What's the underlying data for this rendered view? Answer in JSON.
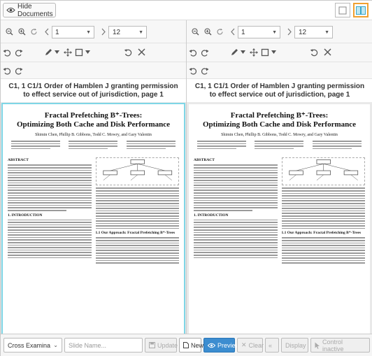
{
  "topbar": {
    "hide_documents_label": "Hide Documents",
    "layout_buttons": [
      "single-view-icon",
      "split-view-icon"
    ]
  },
  "panes": [
    {
      "page_current": "1",
      "page_total": "12",
      "document_title": "C1, 1 C1/1 Order of Hamblen J granting permission to effect service out of jurisdiction, page 1",
      "paper": {
        "title_line1": "Fractal Prefetching B⁺-Trees:",
        "title_line2": "Optimizing Both Cache and Disk Performance",
        "authors": "Shimin Chen, Phillip B. Gibbons, Todd C. Mowry, and Gary Valentin",
        "section_abstract": "ABSTRACT",
        "section_intro": "1. INTRODUCTION",
        "section_approach": "1.1 Our Approach: Fractal Prefetching B⁺-Trees"
      }
    },
    {
      "page_current": "1",
      "page_total": "12",
      "document_title": "C1, 1 C1/1 Order of Hamblen J granting permission to effect service out of jurisdiction, page 1",
      "paper": {
        "title_line1": "Fractal Prefetching B⁺-Trees:",
        "title_line2": "Optimizing Both Cache and Disk Performance",
        "authors": "Shimin Chen, Phillip B. Gibbons, Todd C. Mowry, and Gary Valentin",
        "section_abstract": "ABSTRACT",
        "section_intro": "1. INTRODUCTION",
        "section_approach": "1.1 Our Approach: Fractal Prefetching B⁺-Trees"
      }
    }
  ],
  "bottombar": {
    "mode_select": "Cross Examina",
    "slide_name_placeholder": "Slide Name...",
    "update_label": "Update",
    "new_label": "New",
    "preview_label": "Preview",
    "clear_label": "Clear",
    "display_label": "Display",
    "control_inactive_label": "Control inactive"
  },
  "colors": {
    "preview_button": "#3c8dd0",
    "active_layout_border": "#f0a030",
    "left_paper_highlight": "#7fd6e6"
  }
}
